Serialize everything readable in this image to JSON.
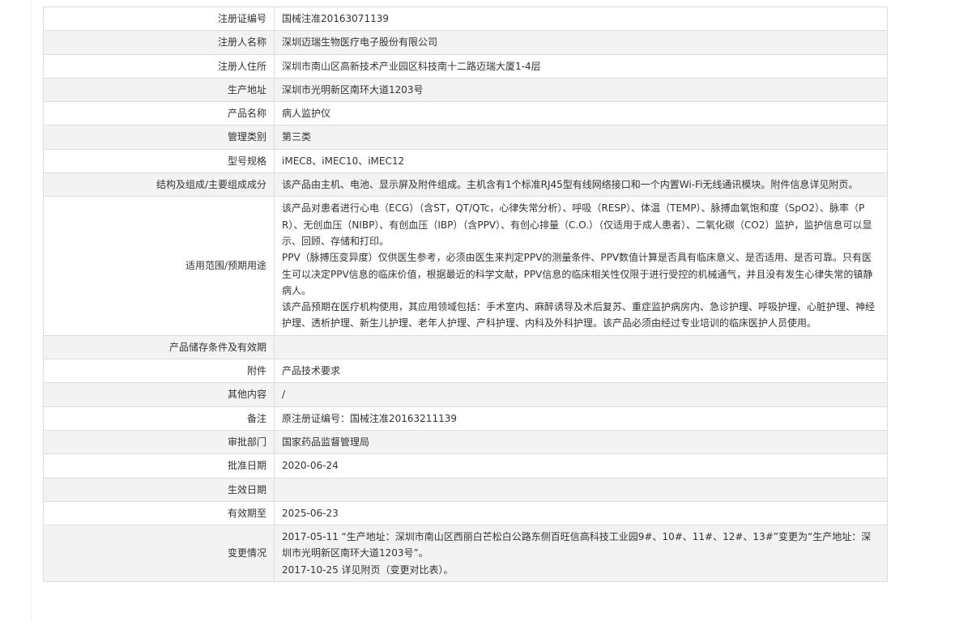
{
  "rows": [
    {
      "label": "注册证编号",
      "value": "国械注准20163071139"
    },
    {
      "label": "注册人名称",
      "value": "深圳迈瑞生物医疗电子股份有限公司"
    },
    {
      "label": "注册人住所",
      "value": "深圳市南山区高新技术产业园区科技南十二路迈瑞大厦1-4层"
    },
    {
      "label": "生产地址",
      "value": "深圳市光明新区南环大道1203号"
    },
    {
      "label": "产品名称",
      "value": "病人监护仪"
    },
    {
      "label": "管理类别",
      "value": "第三类"
    },
    {
      "label": "型号规格",
      "value": "iMEC8、iMEC10、iMEC12"
    },
    {
      "label": "结构及组成/主要组成成分",
      "value": "该产品由主机、电池、显示屏及附件组成。主机含有1个标准RJ45型有线网络接口和一个内置Wi-Fi无线通讯模块。附件信息详见附页。"
    },
    {
      "label": "适用范围/预期用途",
      "paragraphs": [
        "该产品对患者进行心电（ECG）（含ST，QT/QTc，心律失常分析）、呼吸（RESP）、体温（TEMP）、脉搏血氧饱和度（SpO2）、脉率（PR）、无创血压（NIBP）、有创血压（IBP）（含PPV）、有创心排量（C.O.）（仅适用于成人患者）、二氧化碳（CO2）监护，监护信息可以显示、回顾、存储和打印。",
        "PPV（脉搏压变异度）仅供医生参考，必须由医生来判定PPV的测量条件、PPV数值计算是否具有临床意义、是否适用、是否可靠。只有医生可以决定PPV信息的临床价值，根据最近的科学文献，PPV信息的临床相关性仅限于进行受控的机械通气，并且没有发生心律失常的镇静病人。",
        "该产品预期在医疗机构使用，其应用领域包括：手术室内、麻醉诱导及术后复苏、重症监护病房内、急诊护理、呼吸护理、心脏护理、神经护理、透析护理、新生儿护理、老年人护理、产科护理、内科及外科护理。该产品必须由经过专业培训的临床医护人员使用。"
      ]
    },
    {
      "label": "产品储存条件及有效期",
      "value": ""
    },
    {
      "label": "附件",
      "value": "产品技术要求"
    },
    {
      "label": "其他内容",
      "value": "/"
    },
    {
      "label": "备注",
      "value": "原注册证编号：国械注准20163211139"
    },
    {
      "label": "审批部门",
      "value": "国家药品监督管理局"
    },
    {
      "label": "批准日期",
      "value": "2020-06-24"
    },
    {
      "label": "生效日期",
      "value": ""
    },
    {
      "label": "有效期至",
      "value": "2025-06-23"
    },
    {
      "label": "变更情况",
      "paragraphs": [
        "2017-05-11 “生产地址：深圳市南山区西丽白芒松白公路东侧百旺信高科技工业园9#、10#、11#、12#、13#”变更为“生产地址：深圳市光明新区南环大道1203号”。",
        "2017-10-25 详见附页（变更对比表）。"
      ]
    }
  ]
}
